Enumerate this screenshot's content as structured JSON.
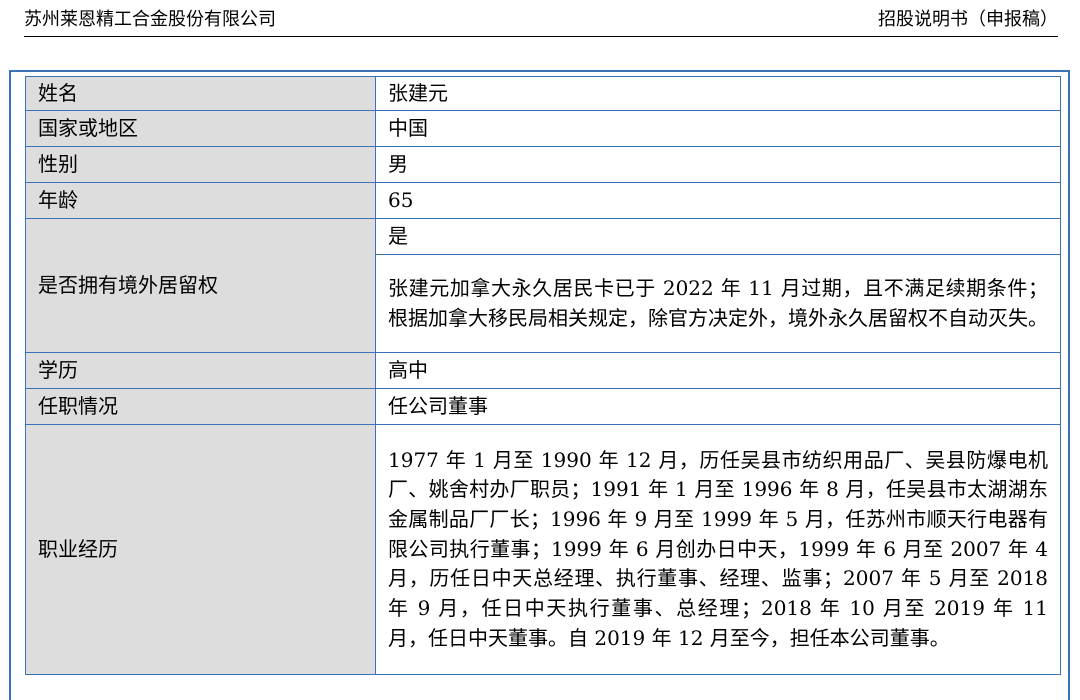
{
  "header": {
    "company": "苏州莱恩精工合金股份有限公司",
    "doc_type": "招股说明书（申报稿）"
  },
  "table": {
    "rows": [
      {
        "label": "姓名",
        "value": "张建元"
      },
      {
        "label": "国家或地区",
        "value": "中国"
      },
      {
        "label": "性别",
        "value": "男"
      },
      {
        "label": "年龄",
        "value": "65"
      },
      {
        "label": "是否拥有境外居留权",
        "value": "是",
        "note": "张建元加拿大永久居民卡已于 2022 年 11 月过期，且不满足续期条件；根据加拿大移民局相关规定，除官方决定外，境外永久居留权不自动灭失。"
      },
      {
        "label": "学历",
        "value": "高中"
      },
      {
        "label": "任职情况",
        "value": "任公司董事"
      },
      {
        "label": "职业经历",
        "value": "1977 年 1 月至 1990 年 12 月，历任吴县市纺织用品厂、吴县防爆电机厂、姚舍村办厂职员；1991 年 1 月至 1996 年 8 月，任吴县市太湖湖东金属制品厂厂长；1996 年 9 月至 1999 年 5 月，任苏州市顺天行电器有限公司执行董事；1999 年 6 月创办日中天，1999 年 6 月至 2007 年 4 月，历任日中天总经理、执行董事、经理、监事；2007 年 5 月至 2018 年 9 月，任日中天执行董事、总经理；2018 年 10 月至 2019 年 11 月，任日中天董事。自 2019 年 12 月至今，担任本公司董事。"
      }
    ]
  }
}
